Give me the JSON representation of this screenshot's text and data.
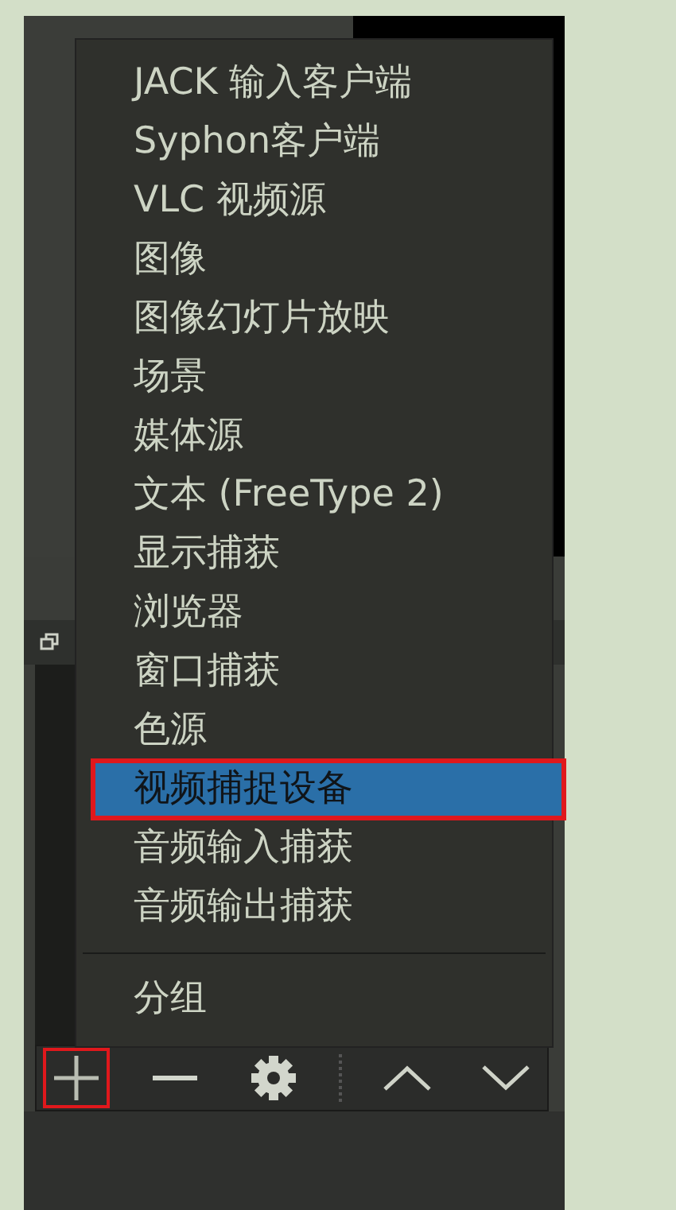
{
  "menu": {
    "items": [
      {
        "kind": "item",
        "label": "JACK 输入客户端",
        "selected": false,
        "marked": false
      },
      {
        "kind": "item",
        "label": "Syphon客户端",
        "selected": false,
        "marked": false
      },
      {
        "kind": "item",
        "label": "VLC 视频源",
        "selected": false,
        "marked": false
      },
      {
        "kind": "item",
        "label": "图像",
        "selected": false,
        "marked": false
      },
      {
        "kind": "item",
        "label": "图像幻灯片放映",
        "selected": false,
        "marked": false
      },
      {
        "kind": "item",
        "label": "场景",
        "selected": false,
        "marked": false
      },
      {
        "kind": "item",
        "label": "媒体源",
        "selected": false,
        "marked": false
      },
      {
        "kind": "item",
        "label": "文本 (FreeType 2)",
        "selected": false,
        "marked": false
      },
      {
        "kind": "item",
        "label": "显示捕获",
        "selected": false,
        "marked": false
      },
      {
        "kind": "item",
        "label": "浏览器",
        "selected": false,
        "marked": false
      },
      {
        "kind": "item",
        "label": "窗口捕获",
        "selected": false,
        "marked": false
      },
      {
        "kind": "item",
        "label": "色源",
        "selected": false,
        "marked": false
      },
      {
        "kind": "item",
        "label": "视频捕捉设备",
        "selected": true,
        "marked": true
      },
      {
        "kind": "item",
        "label": "音频输入捕获",
        "selected": false,
        "marked": false
      },
      {
        "kind": "item",
        "label": "音频输出捕获",
        "selected": false,
        "marked": false
      },
      {
        "kind": "separator"
      },
      {
        "kind": "item",
        "label": "分组",
        "selected": false,
        "marked": false
      }
    ]
  },
  "toolbar": {
    "buttons": [
      {
        "kind": "add",
        "marked": true
      },
      {
        "kind": "remove",
        "marked": false
      },
      {
        "kind": "settings",
        "marked": false
      },
      {
        "kind": "divider"
      },
      {
        "kind": "up",
        "marked": false
      },
      {
        "kind": "down",
        "marked": false
      }
    ]
  }
}
